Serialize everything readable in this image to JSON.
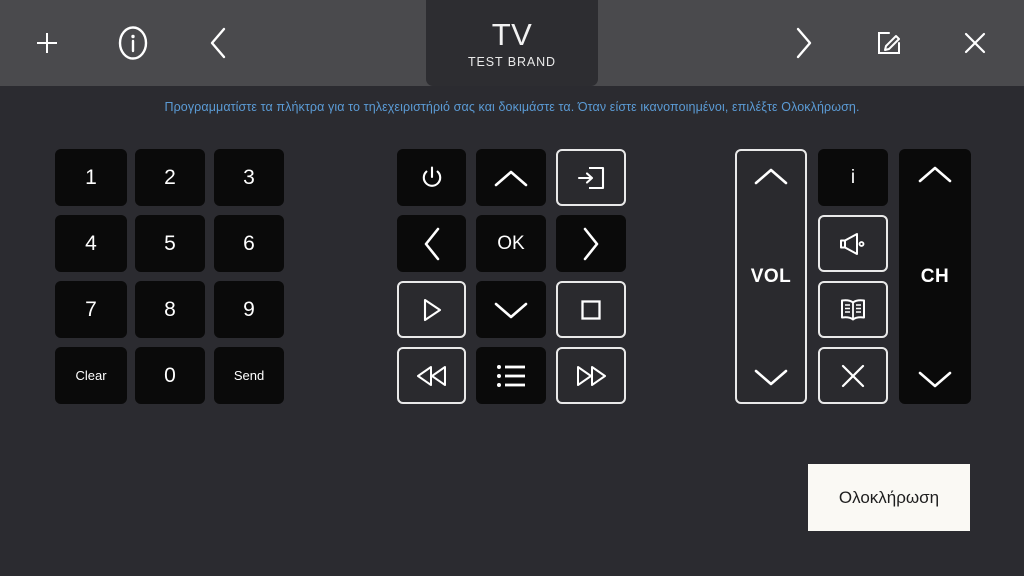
{
  "header": {
    "icons_left": [
      {
        "name": "add-icon",
        "label": "+"
      },
      {
        "name": "info-circle-icon",
        "label": "i"
      },
      {
        "name": "chevron-left-icon",
        "label": "<"
      }
    ],
    "icons_right": [
      {
        "name": "chevron-right-icon",
        "label": ">"
      },
      {
        "name": "edit-icon",
        "label": "edit"
      },
      {
        "name": "close-icon",
        "label": "x"
      }
    ]
  },
  "tab": {
    "title": "TV",
    "subtitle": "TEST BRAND"
  },
  "instruction": "Προγραμματίστε τα πλήκτρα για το τηλεχειριστήριό σας και δοκιμάστε τα. Όταν είστε ικανοποιημένοι, επιλέξτε Ολοκλήρωση.",
  "keypad": {
    "keys": [
      {
        "label": "1"
      },
      {
        "label": "2"
      },
      {
        "label": "3"
      },
      {
        "label": "4"
      },
      {
        "label": "5"
      },
      {
        "label": "6"
      },
      {
        "label": "7"
      },
      {
        "label": "8"
      },
      {
        "label": "9"
      },
      {
        "label": "Clear"
      },
      {
        "label": "0"
      },
      {
        "label": "Send"
      }
    ]
  },
  "navpad": {
    "power": {
      "icon": "power-icon"
    },
    "up": {
      "icon": "chevron-up-icon"
    },
    "input": {
      "icon": "input-source-icon"
    },
    "left": {
      "icon": "chevron-left-icon"
    },
    "ok": {
      "label": "OK"
    },
    "right": {
      "icon": "chevron-right-icon"
    },
    "play": {
      "icon": "play-icon"
    },
    "down": {
      "icon": "chevron-down-icon"
    },
    "stop": {
      "icon": "stop-icon"
    },
    "rewind": {
      "icon": "rewind-icon"
    },
    "menu": {
      "icon": "menu-list-icon"
    },
    "forward": {
      "icon": "fast-forward-icon"
    }
  },
  "sidepad": {
    "volume": {
      "label": "VOL",
      "up_icon": "chevron-up-icon",
      "down_icon": "chevron-down-icon"
    },
    "channel": {
      "label": "CH",
      "up_icon": "chevron-up-icon",
      "down_icon": "chevron-down-icon"
    },
    "info": {
      "label": "i",
      "icon": "info-icon"
    },
    "mute": {
      "icon": "mute-speaker-icon"
    },
    "guide": {
      "icon": "guide-book-icon"
    },
    "exit": {
      "icon": "close-x-icon"
    }
  },
  "finish_button": {
    "label": "Ολοκλήρωση"
  },
  "colors": {
    "header_bg": "#4a4a4d",
    "page_bg": "#2b2b30",
    "tab_bg": "#2d2d31",
    "button_bg": "#0a0a0a",
    "outlined_bg": "#2a2a2e",
    "instruction_text": "#5b9bd5",
    "finish_bg": "#faf9f4"
  }
}
